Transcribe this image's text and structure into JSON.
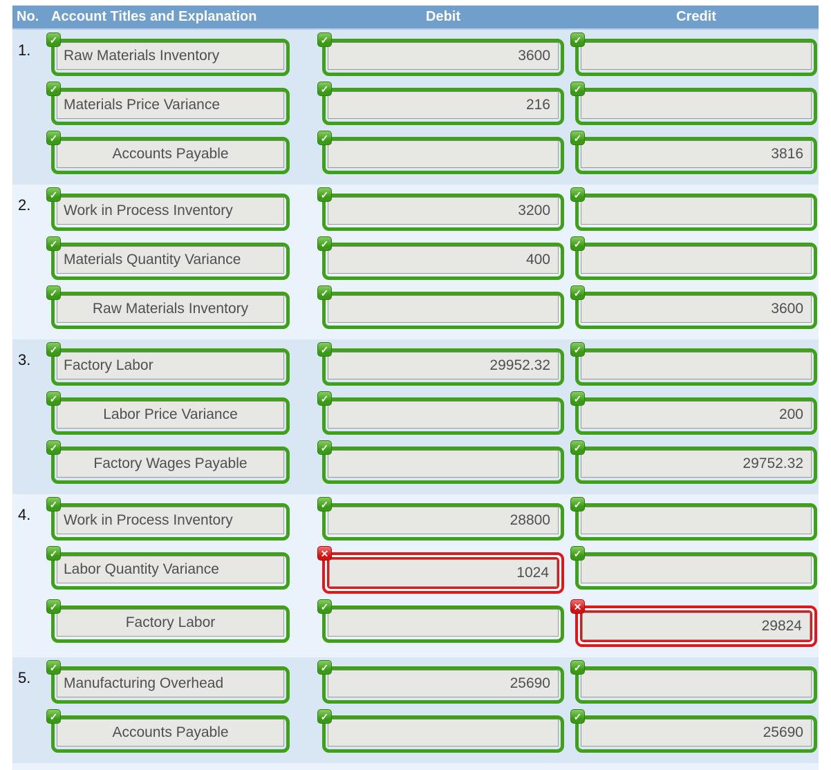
{
  "header": {
    "no": "No.",
    "account": "Account Titles and Explanation",
    "debit": "Debit",
    "credit": "Credit"
  },
  "colors": {
    "header_bg": "#6f9fca",
    "block_odd_bg": "#d9e6f4",
    "block_even_bg": "#eaf2fb",
    "correct_green": "#3ea117",
    "incorrect_red": "#e0181c",
    "field_bg": "#e7e7e4"
  },
  "icons": {
    "correct": "✓",
    "incorrect": "✕"
  },
  "entries": [
    {
      "no": "1.",
      "rows": [
        {
          "account": "Raw Materials Inventory",
          "account_align": "left",
          "account_status": "correct",
          "debit": "3600",
          "debit_status": "correct",
          "credit": "",
          "credit_status": "correct"
        },
        {
          "account": "Materials Price Variance",
          "account_align": "left",
          "account_status": "correct",
          "debit": "216",
          "debit_status": "correct",
          "credit": "",
          "credit_status": "correct"
        },
        {
          "account": "Accounts Payable",
          "account_align": "center",
          "account_status": "correct",
          "debit": "",
          "debit_status": "correct",
          "credit": "3816",
          "credit_status": "correct"
        }
      ]
    },
    {
      "no": "2.",
      "rows": [
        {
          "account": "Work in Process Inventory",
          "account_align": "left",
          "account_status": "correct",
          "debit": "3200",
          "debit_status": "correct",
          "credit": "",
          "credit_status": "correct"
        },
        {
          "account": "Materials Quantity Variance",
          "account_align": "left",
          "account_status": "correct",
          "debit": "400",
          "debit_status": "correct",
          "credit": "",
          "credit_status": "correct"
        },
        {
          "account": "Raw Materials Inventory",
          "account_align": "center",
          "account_status": "correct",
          "debit": "",
          "debit_status": "correct",
          "credit": "3600",
          "credit_status": "correct"
        }
      ]
    },
    {
      "no": "3.",
      "rows": [
        {
          "account": "Factory Labor",
          "account_align": "left",
          "account_status": "correct",
          "debit": "29952.32",
          "debit_status": "correct",
          "credit": "",
          "credit_status": "correct"
        },
        {
          "account": "Labor Price Variance",
          "account_align": "center",
          "account_status": "correct",
          "debit": "",
          "debit_status": "correct",
          "credit": "200",
          "credit_status": "correct"
        },
        {
          "account": "Factory Wages Payable",
          "account_align": "center",
          "account_status": "correct",
          "debit": "",
          "debit_status": "correct",
          "credit": "29752.32",
          "credit_status": "correct"
        }
      ]
    },
    {
      "no": "4.",
      "rows": [
        {
          "account": "Work in Process Inventory",
          "account_align": "left",
          "account_status": "correct",
          "debit": "28800",
          "debit_status": "correct",
          "credit": "",
          "credit_status": "correct"
        },
        {
          "account": "Labor Quantity Variance",
          "account_align": "left",
          "account_status": "correct",
          "debit": "1024",
          "debit_status": "incorrect",
          "credit": "",
          "credit_status": "correct"
        },
        {
          "account": "Factory Labor",
          "account_align": "center",
          "account_status": "correct",
          "debit": "",
          "debit_status": "correct",
          "credit": "29824",
          "credit_status": "incorrect"
        }
      ]
    },
    {
      "no": "5.",
      "rows": [
        {
          "account": "Manufacturing Overhead",
          "account_align": "left",
          "account_status": "correct",
          "debit": "25690",
          "debit_status": "correct",
          "credit": "",
          "credit_status": "correct"
        },
        {
          "account": "Accounts Payable",
          "account_align": "center",
          "account_status": "correct",
          "debit": "",
          "debit_status": "correct",
          "credit": "25690",
          "credit_status": "correct"
        }
      ]
    }
  ]
}
